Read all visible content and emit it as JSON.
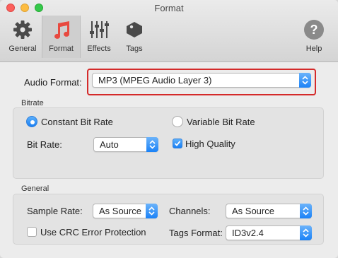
{
  "window": {
    "title": "Format"
  },
  "toolbar": {
    "items": [
      {
        "label": "General",
        "icon": "gear-icon"
      },
      {
        "label": "Format",
        "icon": "music-note-icon",
        "selected": true
      },
      {
        "label": "Effects",
        "icon": "sliders-icon"
      },
      {
        "label": "Tags",
        "icon": "tag-icon"
      }
    ],
    "help": {
      "label": "Help",
      "icon": "help-icon"
    }
  },
  "audio_format": {
    "label": "Audio Format:",
    "value": "MP3 (MPEG Audio Layer 3)"
  },
  "bitrate": {
    "title": "Bitrate",
    "constant": {
      "label": "Constant Bit Rate",
      "selected": true
    },
    "variable": {
      "label": "Variable Bit Rate",
      "selected": false
    },
    "bit_rate_label": "Bit Rate:",
    "bit_rate_value": "Auto",
    "high_quality": {
      "label": "High Quality",
      "checked": true
    }
  },
  "general": {
    "title": "General",
    "sample_rate_label": "Sample Rate:",
    "sample_rate_value": "As Source",
    "channels_label": "Channels:",
    "channels_value": "As Source",
    "crc": {
      "label": "Use CRC Error Protection",
      "checked": false
    },
    "tags_format_label": "Tags Format:",
    "tags_format_value": "ID3v2.4"
  },
  "colors": {
    "accent": "#1a82f7",
    "highlight_border": "#d42a2a",
    "format_icon": "#e8493f"
  }
}
